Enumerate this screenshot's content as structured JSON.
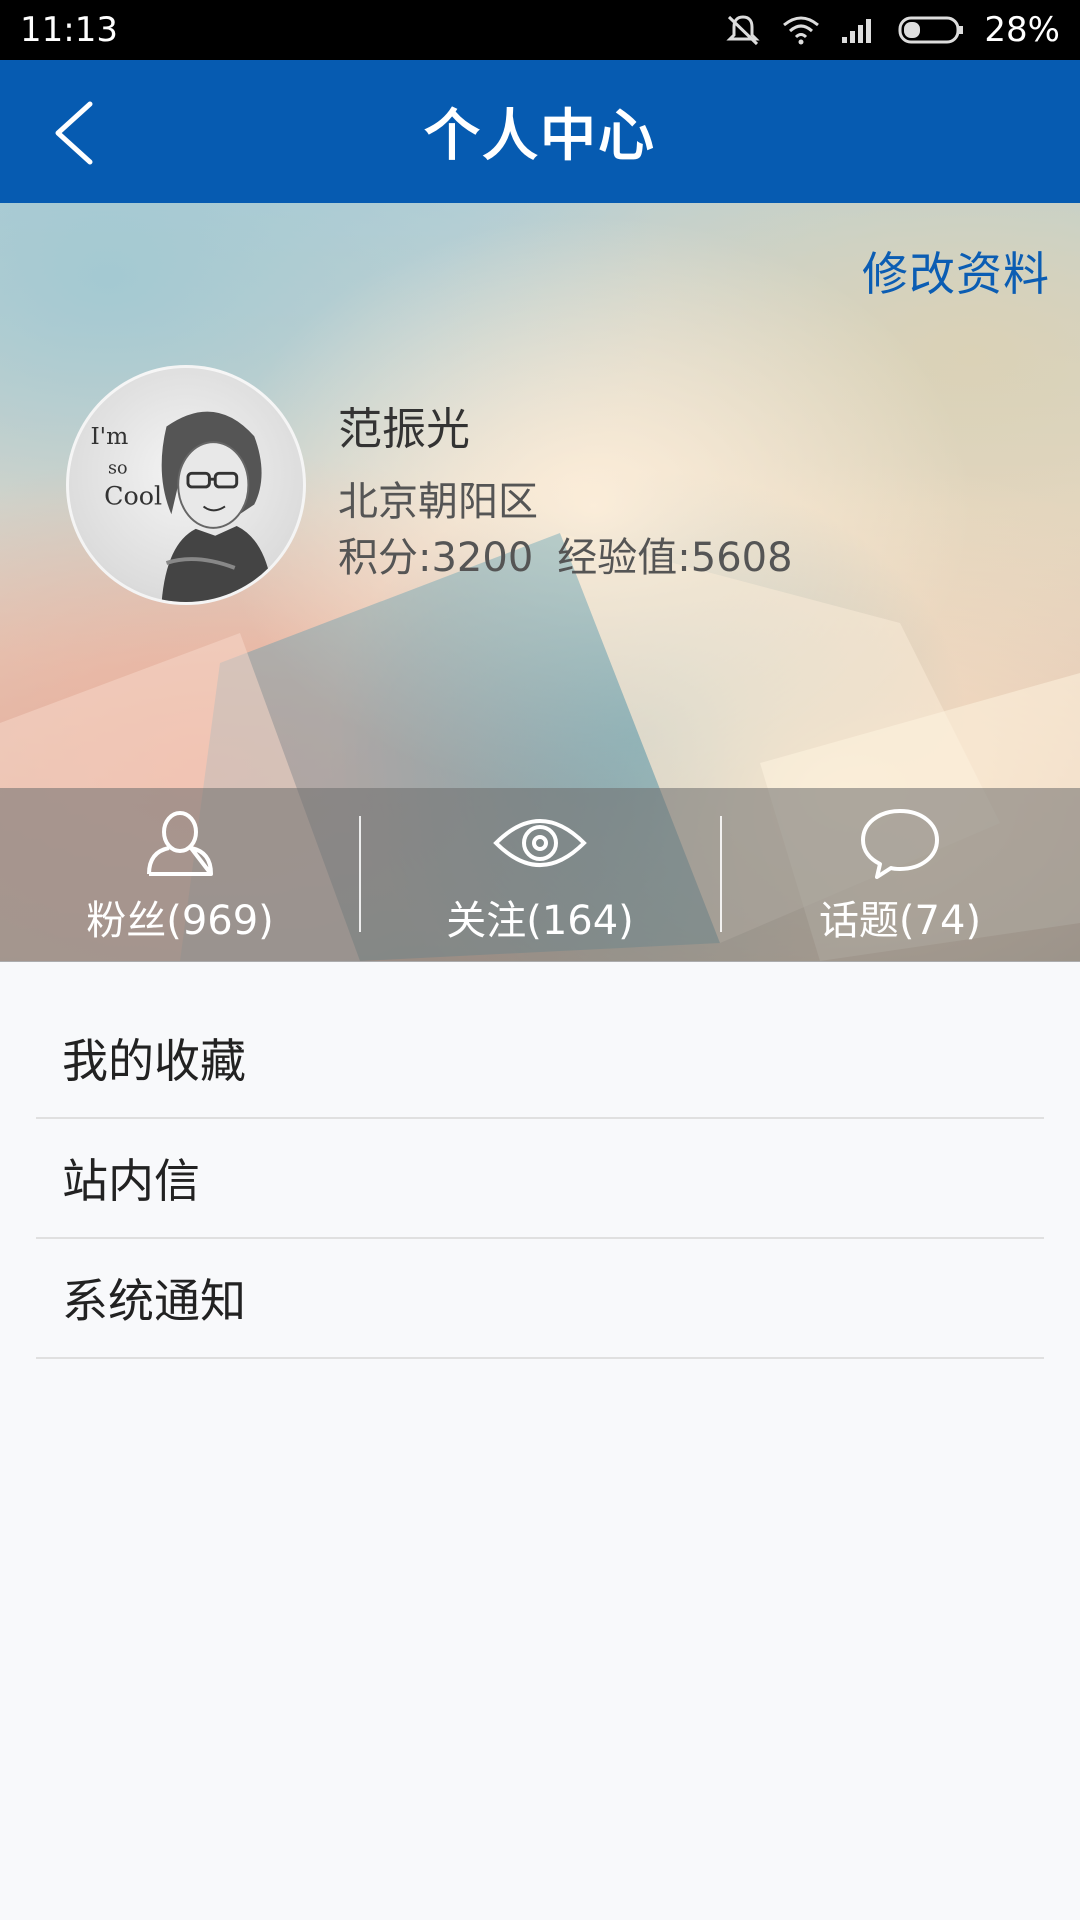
{
  "status_bar": {
    "time": "11:13",
    "battery": "28%",
    "icons": [
      "mute-icon",
      "wifi-icon",
      "signal-icon",
      "battery-icon"
    ]
  },
  "header": {
    "title": "个人中心",
    "back_icon": "back-arrow-icon",
    "color": "#065bb1"
  },
  "profile": {
    "edit_label": "修改资料",
    "name": "范振光",
    "location": "北京朝阳区",
    "points_label": "积分:3200",
    "exp_label": "经验值:5608"
  },
  "stats": [
    {
      "label": "粉丝(969)",
      "icon": "person-icon"
    },
    {
      "label": "关注(164)",
      "icon": "eye-icon"
    },
    {
      "label": "话题(74)",
      "icon": "speech-bubble-icon"
    }
  ],
  "menu": [
    {
      "label": "我的收藏"
    },
    {
      "label": "站内信"
    },
    {
      "label": "系统通知"
    }
  ]
}
